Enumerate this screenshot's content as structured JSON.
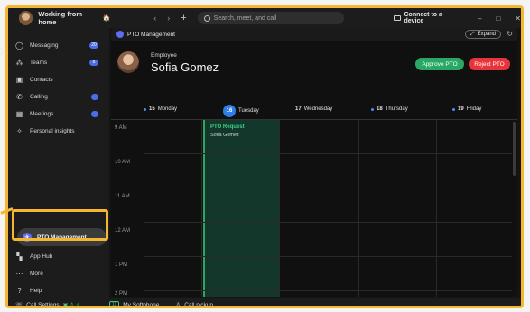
{
  "titlebar": {
    "status": "Working from home",
    "status_emoji": "🏠",
    "search_placeholder": "Search, meet, and call",
    "connect": "Connect to a device"
  },
  "sidebar": {
    "items": [
      {
        "label": "Messaging",
        "badge": "20",
        "icon": "message-icon"
      },
      {
        "label": "Teams",
        "badge": "8",
        "icon": "teams-icon"
      },
      {
        "label": "Contacts",
        "badge": "",
        "icon": "contacts-icon"
      },
      {
        "label": "Calling",
        "badge": "",
        "icon": "phone-icon"
      },
      {
        "label": "Meetings",
        "badge": "",
        "icon": "calendar-icon"
      },
      {
        "label": "Personal insights",
        "badge": "",
        "icon": "insights-icon"
      }
    ],
    "active_app": "PTO Management",
    "lower_items": [
      {
        "label": "App Hub",
        "icon": "apps-icon"
      },
      {
        "label": "More",
        "icon": "more-icon"
      },
      {
        "label": "Help",
        "icon": "help-icon"
      }
    ]
  },
  "bottombar": {
    "call_settings": "Call Settings",
    "softphone_num": "11",
    "softphone": "My Softphone",
    "pickup": "Call pickup"
  },
  "main": {
    "header_title": "PTO Management",
    "expand_label": "Expand",
    "employee_label": "Employee",
    "employee_name": "Sofia Gomez",
    "approve_label": "Approve PTO",
    "reject_label": "Reject PTO"
  },
  "calendar": {
    "days": [
      {
        "num": "15",
        "name": "Monday"
      },
      {
        "num": "16",
        "name": "Tuesday"
      },
      {
        "num": "17",
        "name": "Wednesday"
      },
      {
        "num": "18",
        "name": "Thursday"
      },
      {
        "num": "19",
        "name": "Friday"
      }
    ],
    "times": [
      "9 AM",
      "10 AM",
      "11 AM",
      "12 AM",
      "1 PM",
      "2 PM"
    ],
    "event": {
      "title": "PTO Request",
      "person": "Sofia Gomez"
    }
  },
  "colors": {
    "accent": "#f5b731",
    "approve": "#28a862",
    "reject": "#e8333b",
    "today": "#2f7de8"
  }
}
